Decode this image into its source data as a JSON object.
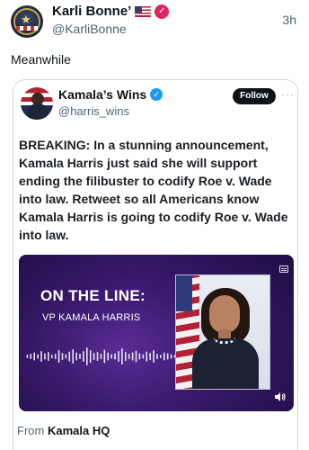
{
  "outer_tweet": {
    "author_name": "Karli Bonne’",
    "author_handle": "@KarliBonne",
    "time": "3h",
    "text": "Meanwhile",
    "icons": [
      "us-flag-emoji",
      "verified-badge-red"
    ]
  },
  "quoted_tweet": {
    "author_name": "Kamala’s Wins",
    "author_handle": "@harris_wins",
    "follow_label": "Follow",
    "more_label": "···",
    "text": "BREAKING: In a stunning announcement, Kamala Harris just said she will support ending the filibuster to codify Roe v. Wade into law. Retweet so all Americans know Kamala Harris is going to codify Roe v. Wade into law.",
    "media": {
      "title": "ON THE LINE:",
      "subtitle": "VP KAMALA HARRIS",
      "icons": [
        "media-menu-icon",
        "speaker-icon",
        "audio-waveform"
      ]
    },
    "from_prefix": "From",
    "from_source": "Kamala HQ"
  },
  "colors": {
    "media_bg": "#3d1b73",
    "verified_blue": "#1d9bf0",
    "verified_red": "#e0245e",
    "follow_bg": "#0f1419"
  }
}
